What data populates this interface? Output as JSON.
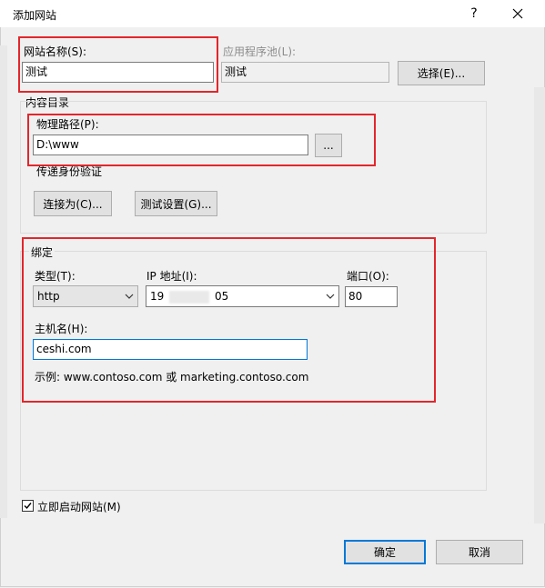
{
  "window": {
    "title": "添加网站",
    "help": "?",
    "close": "✕"
  },
  "site_name": {
    "label": "网站名称(S):",
    "value": "测试"
  },
  "app_pool": {
    "label": "应用程序池(L):",
    "value": "测试",
    "select_button": "选择(E)..."
  },
  "content_dir": {
    "group_label": "内容目录",
    "path_label": "物理路径(P):",
    "path_value": "D:\\www",
    "browse_button": "...",
    "auth_label": "传递身份验证",
    "connect_as_button": "连接为(C)...",
    "test_settings_button": "测试设置(G)..."
  },
  "binding": {
    "group_label": "绑定",
    "type_label": "类型(T):",
    "type_value": "http",
    "ip_label": "IP 地址(I):",
    "ip_value_start": "19",
    "ip_value_end": "05",
    "port_label": "端口(O):",
    "port_value": "80",
    "host_label": "主机名(H):",
    "host_value": "ceshi.com",
    "example_text": "示例: www.contoso.com 或 marketing.contoso.com"
  },
  "start_now": {
    "label": "立即启动网站(M)",
    "checked": true
  },
  "footer": {
    "ok": "确定",
    "cancel": "取消"
  },
  "colors": {
    "highlight": "#e3262b",
    "accent": "#0078d7"
  }
}
